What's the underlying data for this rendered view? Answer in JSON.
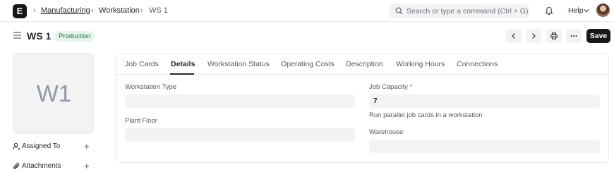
{
  "navbar": {
    "logo": "E",
    "breadcrumbs": [
      "Manufacturing",
      "Workstation",
      "WS 1"
    ],
    "search_placeholder": "Search or type a command (Ctrl + G)",
    "help_label": "Help"
  },
  "page": {
    "title": "WS 1",
    "status": "Production",
    "save_label": "Save"
  },
  "sidebar": {
    "image_initials": "W1",
    "items": [
      {
        "label": "Assigned To"
      },
      {
        "label": "Attachments"
      }
    ]
  },
  "tabs": [
    "Job Cards",
    "Details",
    "Workstation Status",
    "Operating Costs",
    "Description",
    "Working Hours",
    "Connections"
  ],
  "active_tab": "Details",
  "form": {
    "workstation_type": {
      "label": "Workstation Type",
      "value": ""
    },
    "plant_floor": {
      "label": "Plant Floor",
      "value": ""
    },
    "job_capacity": {
      "label": "Job Capacity",
      "required_mark": "*",
      "value": "7",
      "description": "Run parallel job cards in a workstation"
    },
    "warehouse": {
      "label": "Warehouse",
      "value": ""
    }
  },
  "colors": {
    "status_bg": "#e4f5e9",
    "status_text": "#16794c",
    "primary_button": "#171717",
    "input_bg": "#f3f3f3"
  },
  "icons": [
    "app-logo",
    "search-icon",
    "bell-icon",
    "chevron-down-icon",
    "menu-icon",
    "chevron-left-icon",
    "chevron-right-icon",
    "printer-icon",
    "more-icon",
    "assign-icon",
    "attachment-icon",
    "plus-icon"
  ]
}
